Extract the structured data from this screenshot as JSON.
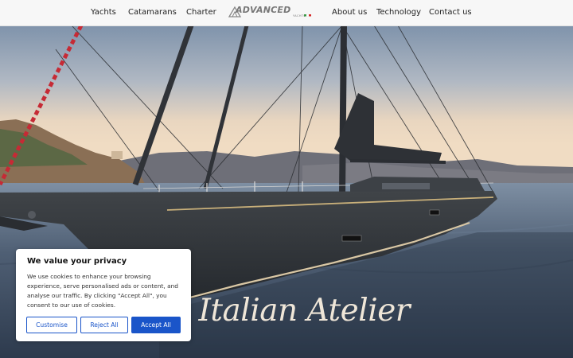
{
  "nav": {
    "items": [
      {
        "label": "Yachts"
      },
      {
        "label": "Catamarans"
      },
      {
        "label": "Charter"
      },
      {
        "label": "About us"
      },
      {
        "label": "Technology"
      },
      {
        "label": "Contact us"
      }
    ],
    "logo": {
      "text": "ADVANCED",
      "subtext": "YACHTS"
    }
  },
  "hero": {
    "headline": "e Italian Atelier"
  },
  "cookie": {
    "title": "We value your privacy",
    "text": "We use cookies to enhance your browsing experience, serve personalised ads or content, and analyse our traffic. By clicking \"Accept All\", you consent to our use of cookies.",
    "buttons": {
      "customise": "Customise",
      "reject": "Reject All",
      "accept": "Accept All"
    }
  },
  "colors": {
    "accent": "#1a55c9",
    "nav_bg": "#f7f7f7"
  }
}
